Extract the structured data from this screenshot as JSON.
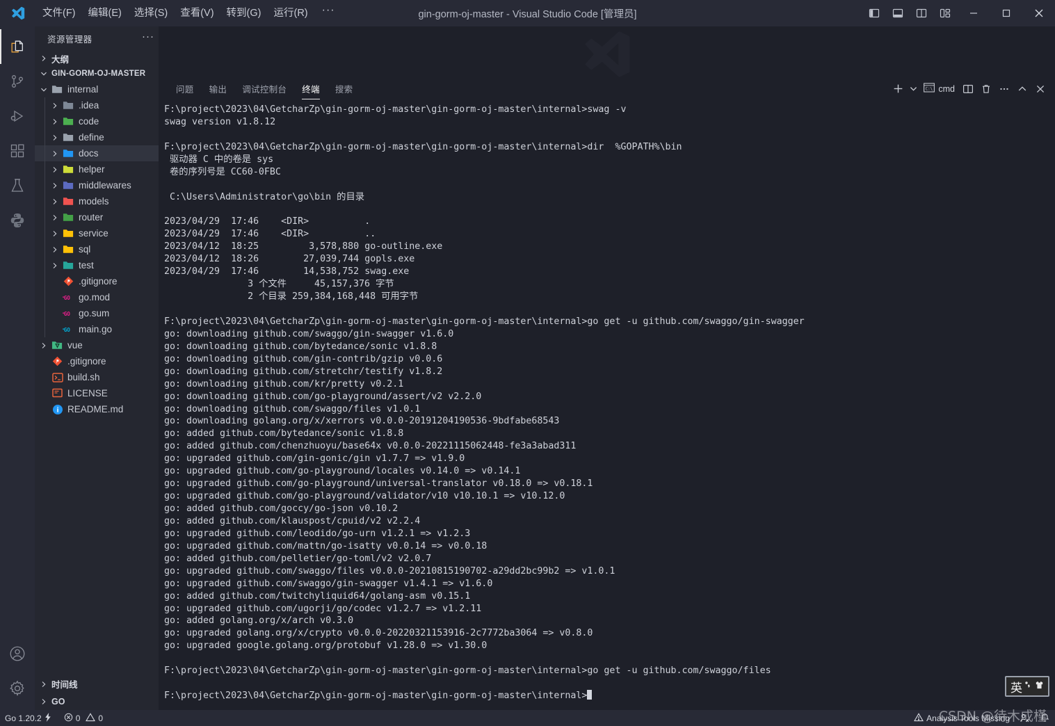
{
  "titlebar": {
    "window_title": "gin-gorm-oj-master - Visual Studio Code [管理员]",
    "menus": [
      {
        "label": "文件(F)",
        "name": "menu-file"
      },
      {
        "label": "编辑(E)",
        "name": "menu-edit"
      },
      {
        "label": "选择(S)",
        "name": "menu-selection"
      },
      {
        "label": "查看(V)",
        "name": "menu-view"
      },
      {
        "label": "转到(G)",
        "name": "menu-go"
      },
      {
        "label": "运行(R)",
        "name": "menu-run"
      }
    ],
    "more_label": "···",
    "layout_buttons": [
      {
        "name": "toggle-primary-sidebar-icon",
        "title": "切换主侧栏"
      },
      {
        "name": "toggle-panel-icon",
        "title": "切换面板"
      },
      {
        "name": "toggle-secondary-sidebar-icon",
        "title": "切换辅助侧栏"
      },
      {
        "name": "customize-layout-icon",
        "title": "自定义布局"
      }
    ],
    "window_buttons": [
      {
        "name": "minimize-button",
        "glyph": "—"
      },
      {
        "name": "maximize-button",
        "glyph": "□"
      },
      {
        "name": "close-button",
        "glyph": "✕"
      }
    ]
  },
  "activitybar": {
    "items": [
      {
        "name": "activity-explorer",
        "icon": "files-icon",
        "active": true
      },
      {
        "name": "activity-source-control",
        "icon": "source-control-icon",
        "active": false
      },
      {
        "name": "activity-run-debug",
        "icon": "run-debug-icon",
        "active": false
      },
      {
        "name": "activity-extensions",
        "icon": "extensions-icon",
        "active": false
      },
      {
        "name": "activity-testing",
        "icon": "beaker-icon",
        "active": false
      },
      {
        "name": "activity-python",
        "icon": "python-icon",
        "active": false
      }
    ],
    "bottom": [
      {
        "name": "activity-accounts",
        "icon": "account-icon"
      },
      {
        "name": "activity-settings",
        "icon": "gear-icon"
      }
    ]
  },
  "sidebar": {
    "header_title": "资源管理器",
    "header_more": "···",
    "outline_label": "大纲",
    "project_label": "GIN-GORM-OJ-MASTER",
    "tree": [
      {
        "label": "internal",
        "depth": 1,
        "type": "folder",
        "expanded": true,
        "icon": "folder-open-icon",
        "color": "#9aa2ad",
        "selected": false
      },
      {
        "label": ".idea",
        "depth": 2,
        "type": "folder",
        "expanded": false,
        "icon": "folder-idea-icon",
        "color": "#7e8896",
        "selected": false
      },
      {
        "label": "code",
        "depth": 2,
        "type": "folder",
        "expanded": false,
        "icon": "folder-code-icon",
        "color": "#4caf50",
        "selected": false
      },
      {
        "label": "define",
        "depth": 2,
        "type": "folder",
        "expanded": false,
        "icon": "folder-icon",
        "color": "#9aa2ad",
        "selected": false
      },
      {
        "label": "docs",
        "depth": 2,
        "type": "folder",
        "expanded": false,
        "icon": "folder-docs-icon",
        "color": "#2196f3",
        "selected": true
      },
      {
        "label": "helper",
        "depth": 2,
        "type": "folder",
        "expanded": false,
        "icon": "folder-helper-icon",
        "color": "#cddc39",
        "selected": false
      },
      {
        "label": "middlewares",
        "depth": 2,
        "type": "folder",
        "expanded": false,
        "icon": "folder-middleware-icon",
        "color": "#5c6bc0",
        "selected": false
      },
      {
        "label": "models",
        "depth": 2,
        "type": "folder",
        "expanded": false,
        "icon": "folder-models-icon",
        "color": "#ef5350",
        "selected": false
      },
      {
        "label": "router",
        "depth": 2,
        "type": "folder",
        "expanded": false,
        "icon": "folder-router-icon",
        "color": "#43a047",
        "selected": false
      },
      {
        "label": "service",
        "depth": 2,
        "type": "folder",
        "expanded": false,
        "icon": "folder-service-icon",
        "color": "#ffc107",
        "selected": false
      },
      {
        "label": "sql",
        "depth": 2,
        "type": "folder",
        "expanded": false,
        "icon": "folder-sql-icon",
        "color": "#ffc107",
        "selected": false
      },
      {
        "label": "test",
        "depth": 2,
        "type": "folder",
        "expanded": false,
        "icon": "folder-test-icon",
        "color": "#26a69a",
        "selected": false
      },
      {
        "label": ".gitignore",
        "depth": 2,
        "type": "file",
        "expanded": null,
        "icon": "git-file-icon",
        "color": "#f05133",
        "selected": false
      },
      {
        "label": "go.mod",
        "depth": 2,
        "type": "file",
        "expanded": null,
        "icon": "go-mod-icon",
        "color": "#e91e8c",
        "selected": false
      },
      {
        "label": "go.sum",
        "depth": 2,
        "type": "file",
        "expanded": null,
        "icon": "go-mod-icon",
        "color": "#e91e8c",
        "selected": false
      },
      {
        "label": "main.go",
        "depth": 2,
        "type": "file",
        "expanded": null,
        "icon": "go-file-icon",
        "color": "#00acd7",
        "selected": false
      },
      {
        "label": "vue",
        "depth": 1,
        "type": "folder",
        "expanded": false,
        "icon": "folder-vue-icon",
        "color": "#41b883",
        "selected": false
      },
      {
        "label": ".gitignore",
        "depth": 1,
        "type": "file",
        "expanded": null,
        "icon": "git-file-icon",
        "color": "#f05133",
        "selected": false
      },
      {
        "label": "build.sh",
        "depth": 1,
        "type": "file",
        "expanded": null,
        "icon": "shell-file-icon",
        "color": "#e8643c",
        "selected": false
      },
      {
        "label": "LICENSE",
        "depth": 1,
        "type": "file",
        "expanded": null,
        "icon": "license-file-icon",
        "color": "#e8643c",
        "selected": false
      },
      {
        "label": "README.md",
        "depth": 1,
        "type": "file",
        "expanded": null,
        "icon": "info-file-icon",
        "color": "#2196f3",
        "selected": false
      }
    ],
    "bottom_sections": [
      {
        "label": "时间线",
        "name": "sidebar-section-timeline"
      },
      {
        "label": "GO",
        "name": "sidebar-section-go"
      }
    ]
  },
  "panel": {
    "tabs": [
      {
        "label": "问题",
        "name": "tab-problems",
        "active": false
      },
      {
        "label": "输出",
        "name": "tab-output",
        "active": false
      },
      {
        "label": "调试控制台",
        "name": "tab-debug-console",
        "active": false
      },
      {
        "label": "终端",
        "name": "tab-terminal",
        "active": true
      },
      {
        "label": "搜索",
        "name": "tab-search",
        "active": false
      }
    ],
    "terminal_name": "cmd",
    "tools": [
      {
        "name": "new-terminal-button",
        "icon": "plus-icon"
      },
      {
        "name": "terminal-profile-button",
        "icon": "chevron-down-icon"
      },
      {
        "name": "terminal-selector",
        "icon": "terminal-icon"
      },
      {
        "name": "split-terminal-button",
        "icon": "split-icon"
      },
      {
        "name": "kill-terminal-button",
        "icon": "trash-icon"
      },
      {
        "name": "panel-more-button",
        "icon": "ellipsis-icon"
      },
      {
        "name": "maximize-panel-button",
        "icon": "chevron-up-icon"
      },
      {
        "name": "close-panel-button",
        "icon": "close-icon"
      }
    ]
  },
  "terminal": {
    "lines": [
      "F:\\project\\2023\\04\\GetcharZp\\gin-gorm-oj-master\\gin-gorm-oj-master\\internal>swag -v",
      "swag version v1.8.12",
      "",
      "F:\\project\\2023\\04\\GetcharZp\\gin-gorm-oj-master\\gin-gorm-oj-master\\internal>dir  %GOPATH%\\bin",
      " 驱动器 C 中的卷是 sys",
      " 卷的序列号是 CC60-0FBC",
      "",
      " C:\\Users\\Administrator\\go\\bin 的目录",
      "",
      "2023/04/29  17:46    <DIR>          .",
      "2023/04/29  17:46    <DIR>          ..",
      "2023/04/12  18:25         3,578,880 go-outline.exe",
      "2023/04/12  18:26        27,039,744 gopls.exe",
      "2023/04/29  17:46        14,538,752 swag.exe",
      "               3 个文件     45,157,376 字节",
      "               2 个目录 259,384,168,448 可用字节",
      "",
      "F:\\project\\2023\\04\\GetcharZp\\gin-gorm-oj-master\\gin-gorm-oj-master\\internal>go get -u github.com/swaggo/gin-swagger",
      "go: downloading github.com/swaggo/gin-swagger v1.6.0",
      "go: downloading github.com/bytedance/sonic v1.8.8",
      "go: downloading github.com/gin-contrib/gzip v0.0.6",
      "go: downloading github.com/stretchr/testify v1.8.2",
      "go: downloading github.com/kr/pretty v0.2.1",
      "go: downloading github.com/go-playground/assert/v2 v2.2.0",
      "go: downloading github.com/swaggo/files v1.0.1",
      "go: downloading golang.org/x/xerrors v0.0.0-20191204190536-9bdfabe68543",
      "go: added github.com/bytedance/sonic v1.8.8",
      "go: added github.com/chenzhuoyu/base64x v0.0.0-20221115062448-fe3a3abad311",
      "go: upgraded github.com/gin-gonic/gin v1.7.7 => v1.9.0",
      "go: upgraded github.com/go-playground/locales v0.14.0 => v0.14.1",
      "go: upgraded github.com/go-playground/universal-translator v0.18.0 => v0.18.1",
      "go: upgraded github.com/go-playground/validator/v10 v10.10.1 => v10.12.0",
      "go: added github.com/goccy/go-json v0.10.2",
      "go: added github.com/klauspost/cpuid/v2 v2.2.4",
      "go: upgraded github.com/leodido/go-urn v1.2.1 => v1.2.3",
      "go: upgraded github.com/mattn/go-isatty v0.0.14 => v0.0.18",
      "go: added github.com/pelletier/go-toml/v2 v2.0.7",
      "go: upgraded github.com/swaggo/files v0.0.0-20210815190702-a29dd2bc99b2 => v1.0.1",
      "go: upgraded github.com/swaggo/gin-swagger v1.4.1 => v1.6.0",
      "go: added github.com/twitchyliquid64/golang-asm v0.15.1",
      "go: upgraded github.com/ugorji/go/codec v1.2.7 => v1.2.11",
      "go: added golang.org/x/arch v0.3.0",
      "go: upgraded golang.org/x/crypto v0.0.0-20220321153916-2c7772ba3064 => v0.8.0",
      "go: upgraded google.golang.org/protobuf v1.28.0 => v1.30.0",
      "",
      "F:\\project\\2023\\04\\GetcharZp\\gin-gorm-oj-master\\gin-gorm-oj-master\\internal>go get -u github.com/swaggo/files",
      ""
    ],
    "prompt_last": "F:\\project\\2023\\04\\GetcharZp\\gin-gorm-oj-master\\gin-gorm-oj-master\\internal>"
  },
  "statusbar": {
    "go_version": "Go 1.20.2",
    "errors": "0",
    "warnings": "0",
    "analysis_tools": "Analysis Tools Missing"
  },
  "ime": {
    "mode": "英"
  },
  "watermark": {
    "text": "CSDN @待木成槿"
  },
  "colors": {
    "titlebar_bg": "#282a36",
    "activitybar_bg": "#282a36",
    "sidebar_bg": "#252730",
    "editor_bg": "#1e2029",
    "statusbar_bg": "#282a36",
    "accent": "#007acc",
    "text": "#cfd2da"
  }
}
